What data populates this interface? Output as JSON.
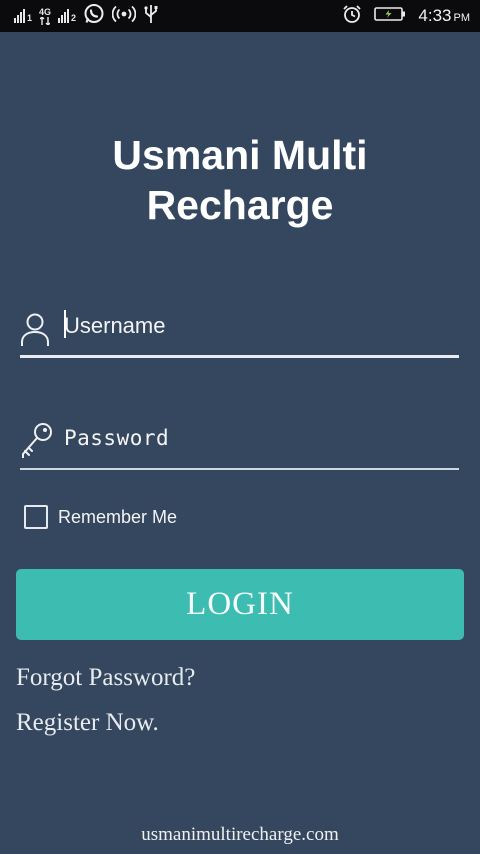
{
  "status_bar": {
    "network_label": "4G",
    "sim1_label": "1",
    "sim2_label": "2",
    "time": "4:33",
    "ampm": "PM",
    "icons": [
      "signal-sim1-icon",
      "signal-4g-icon",
      "signal-sim2-icon",
      "whatsapp-icon",
      "hotspot-icon",
      "usb-icon",
      "alarm-icon",
      "battery-charging-icon"
    ]
  },
  "app": {
    "title_line1": "Usmani Multi",
    "title_line2": "Recharge"
  },
  "form": {
    "username_placeholder": "Username",
    "password_placeholder": "Password",
    "remember_label": "Remember Me",
    "login_label": "LOGIN",
    "forgot_label": "Forgot Password?",
    "register_label": "Register Now."
  },
  "footer": {
    "domain": "usmanimultirecharge.com"
  },
  "colors": {
    "background": "#34475f",
    "status_bar": "#0b0b0d",
    "accent": "#3dbdb2"
  }
}
